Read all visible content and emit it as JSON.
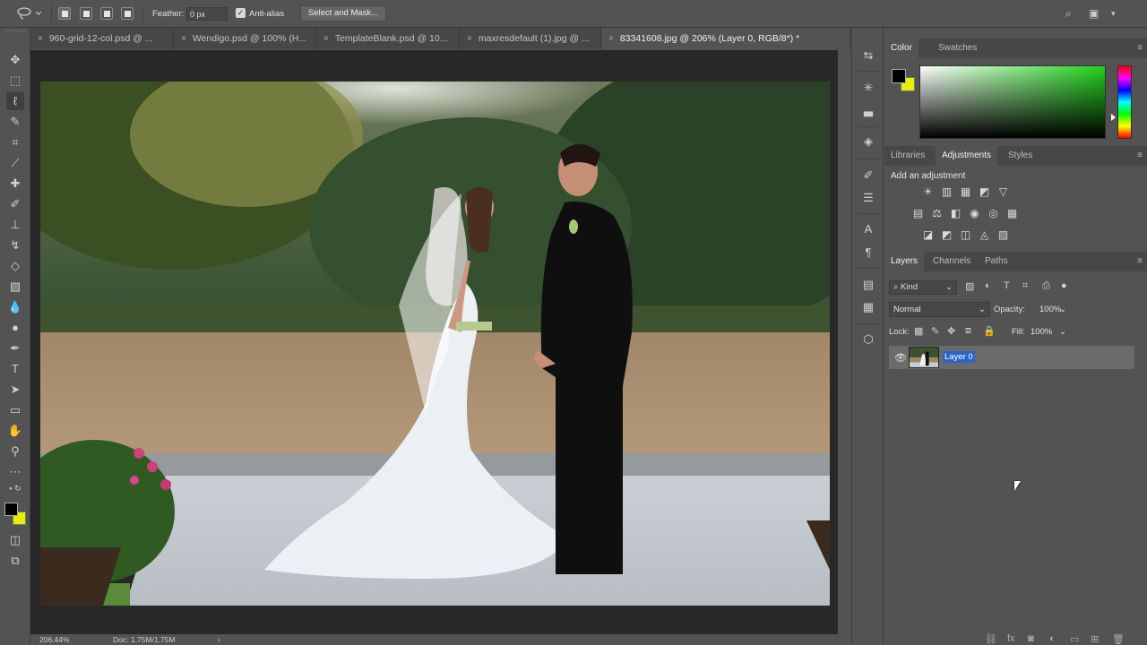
{
  "options_bar": {
    "feather_label": "Feather:",
    "feather_value": "0 px",
    "antialias_label": "Anti-alias",
    "antialias_checked": true,
    "select_mask_label": "Select and Mask..."
  },
  "tabs": [
    {
      "label": "960-grid-12-col.psd @ ...",
      "active": false
    },
    {
      "label": "Wendigo.psd @ 100% (H...",
      "active": false
    },
    {
      "label": "TemplateBlank.psd @ 10...",
      "active": false
    },
    {
      "label": "maxresdefault (1).jpg @ ...",
      "active": false
    },
    {
      "label": "83341608.jpg @ 206% (Layer 0, RGB/8*) *",
      "active": true
    }
  ],
  "status": {
    "zoom": "206.44%",
    "doc": "Doc: 1.75M/1.75M",
    "arrow": "›"
  },
  "color_panel": {
    "tabs": [
      "Color",
      "Swatches"
    ],
    "foreground": "#000000",
    "background": "#e7ef00",
    "picker_hue": "#21d21a"
  },
  "adjustments_panel": {
    "tabs": [
      "Libraries",
      "Adjustments",
      "Styles"
    ],
    "title": "Add an adjustment",
    "row1": [
      "☀",
      "▥",
      "▦",
      "◩",
      "▽"
    ],
    "row2": [
      "▤",
      "⚖",
      "◧",
      "◉",
      "◎",
      "▦"
    ],
    "row3": [
      "◪",
      "◩",
      "◫",
      "◬",
      "▨"
    ]
  },
  "layers_panel": {
    "tabs": [
      "Layers",
      "Channels",
      "Paths"
    ],
    "kind_label": "Kind",
    "blend_mode": "Normal",
    "opacity_label": "Opacity:",
    "opacity_value": "100%",
    "lock_label": "Lock:",
    "fill_label": "Fill:",
    "fill_value": "100%",
    "layers": [
      {
        "name": "Layer 0",
        "visible": true,
        "selected": true
      }
    ]
  }
}
